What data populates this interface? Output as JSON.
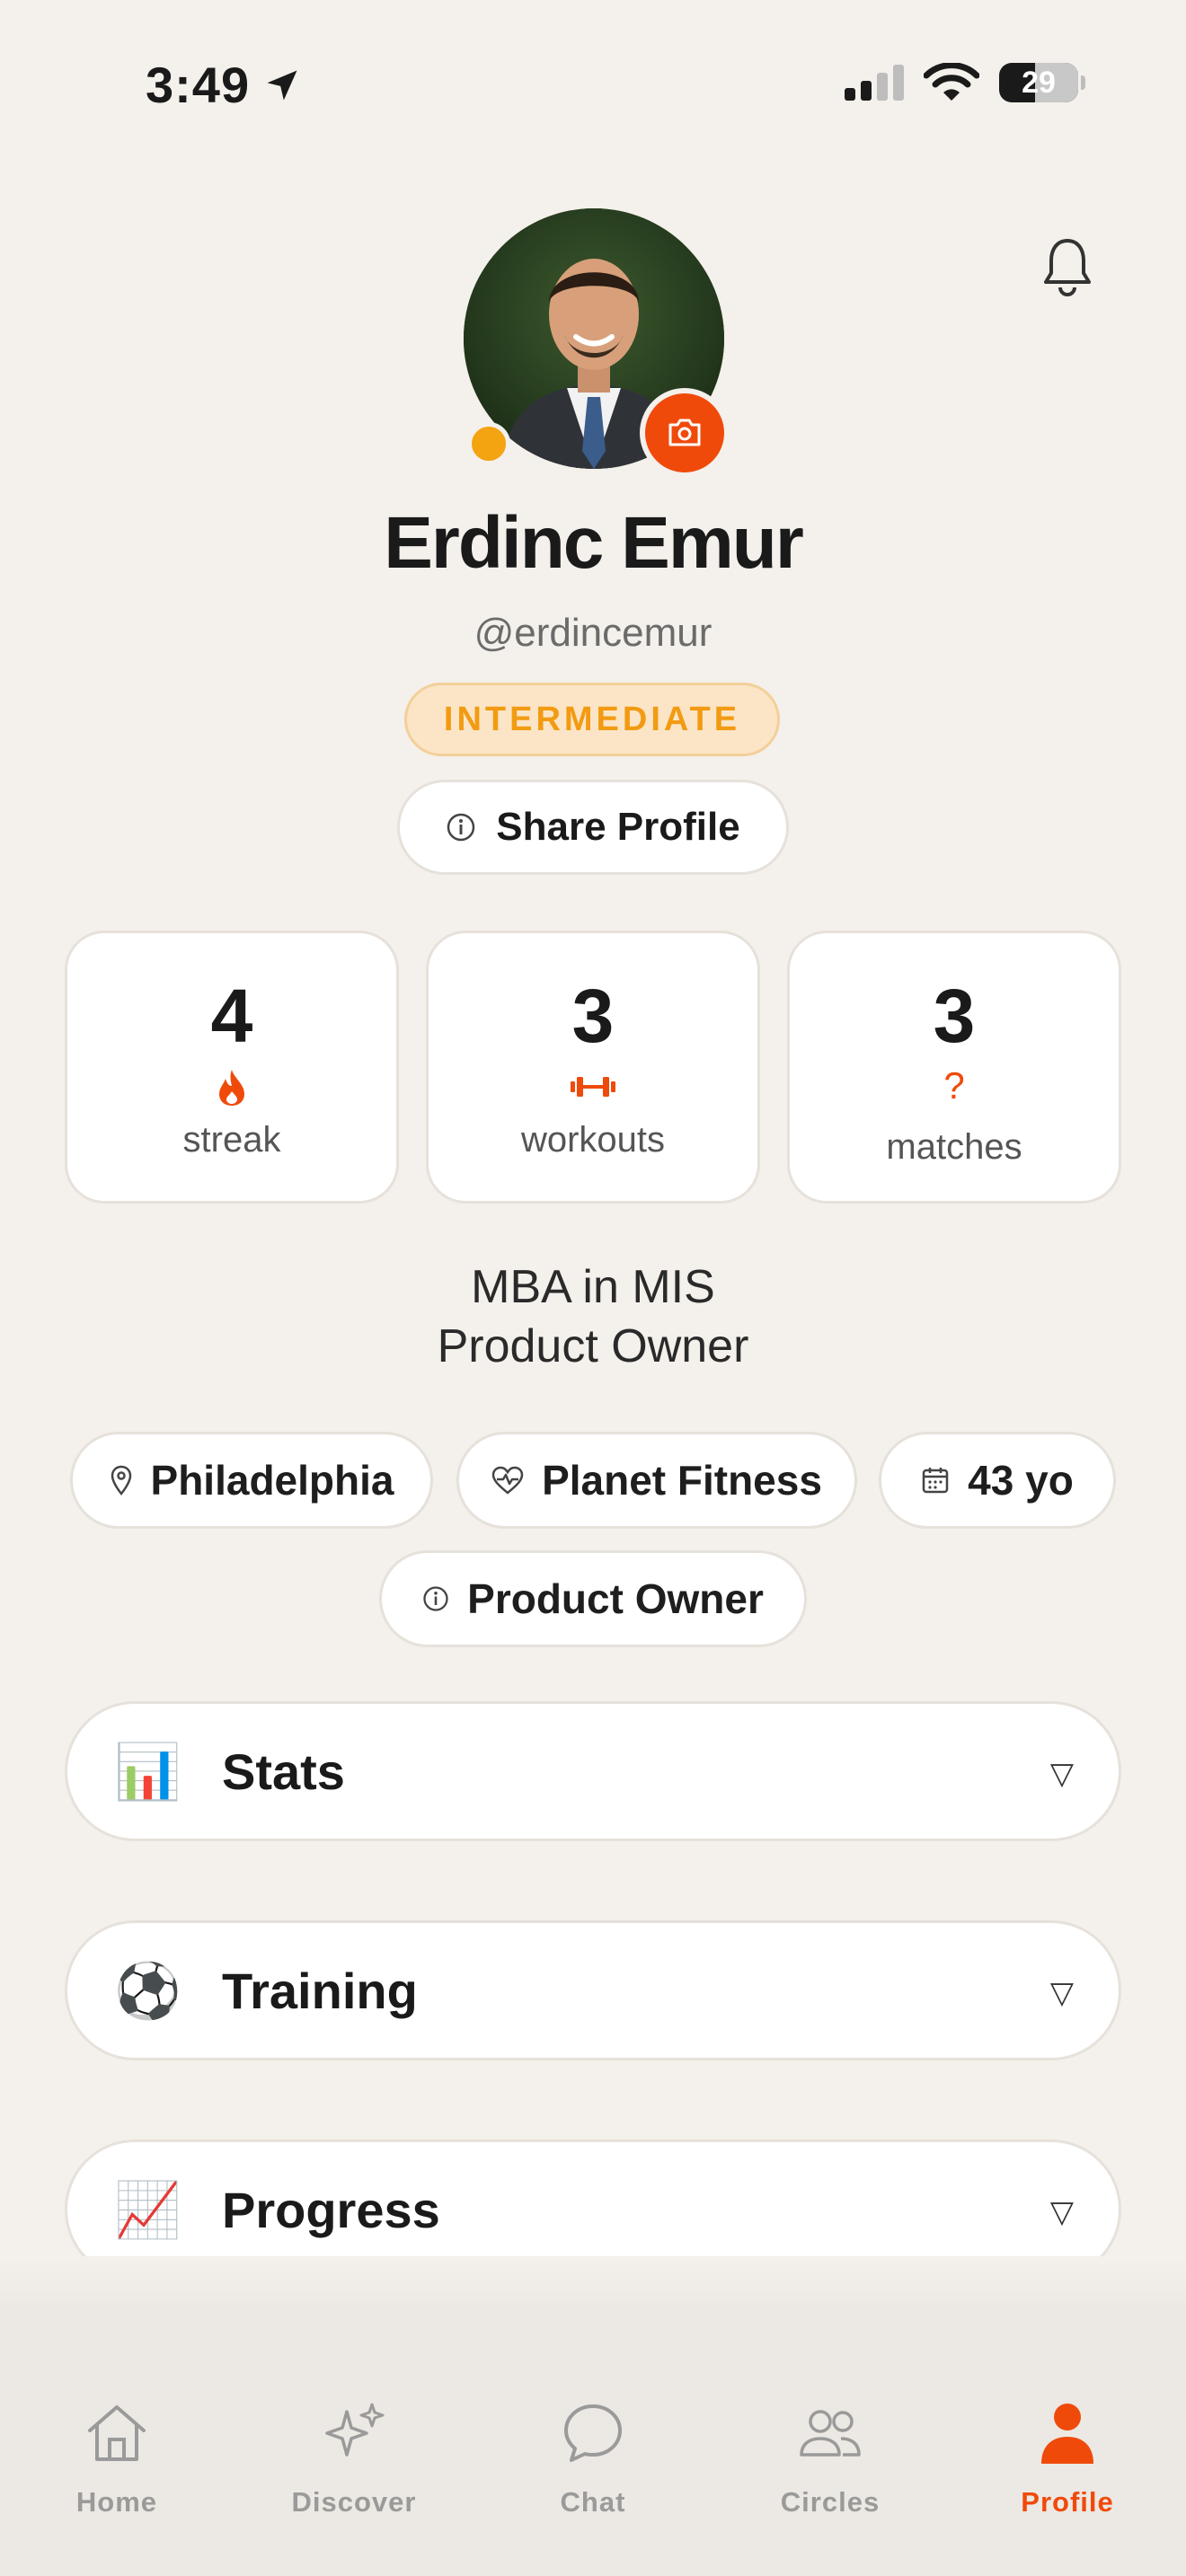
{
  "status_bar": {
    "time": "3:49",
    "battery": "29"
  },
  "profile": {
    "name": "Erdinc Emur",
    "handle": "@erdincemur",
    "level": "INTERMEDIATE",
    "share_label": "Share Profile"
  },
  "stats": [
    {
      "value": "4",
      "label": "streak",
      "icon": "flame-icon"
    },
    {
      "value": "3",
      "label": "workouts",
      "icon": "dumbbell-icon"
    },
    {
      "value": "3",
      "label": "matches",
      "icon": "question-icon"
    }
  ],
  "bio": {
    "line1": "MBA in MIS",
    "line2": "Product Owner"
  },
  "chips": [
    {
      "label": "Philadelphia",
      "icon": "location-pin-icon"
    },
    {
      "label": "Planet Fitness",
      "icon": "heart-pulse-icon"
    },
    {
      "label": "43 yo",
      "icon": "calendar-icon"
    },
    {
      "label": "Product Owner",
      "icon": "info-icon"
    }
  ],
  "sections": [
    {
      "label": "Stats",
      "emoji": "📊"
    },
    {
      "label": "Training",
      "emoji": "⚽"
    },
    {
      "label": "Progress",
      "emoji": "📈"
    }
  ],
  "tabs": [
    {
      "label": "Home",
      "icon": "home-icon",
      "active": false
    },
    {
      "label": "Discover",
      "icon": "sparkles-icon",
      "active": false
    },
    {
      "label": "Chat",
      "icon": "chat-bubble-icon",
      "active": false
    },
    {
      "label": "Circles",
      "icon": "people-icon",
      "active": false
    },
    {
      "label": "Profile",
      "icon": "person-icon",
      "active": true
    }
  ],
  "colors": {
    "accent": "#f04a0b",
    "level": "#f29b12",
    "background": "#f4f0eb"
  }
}
